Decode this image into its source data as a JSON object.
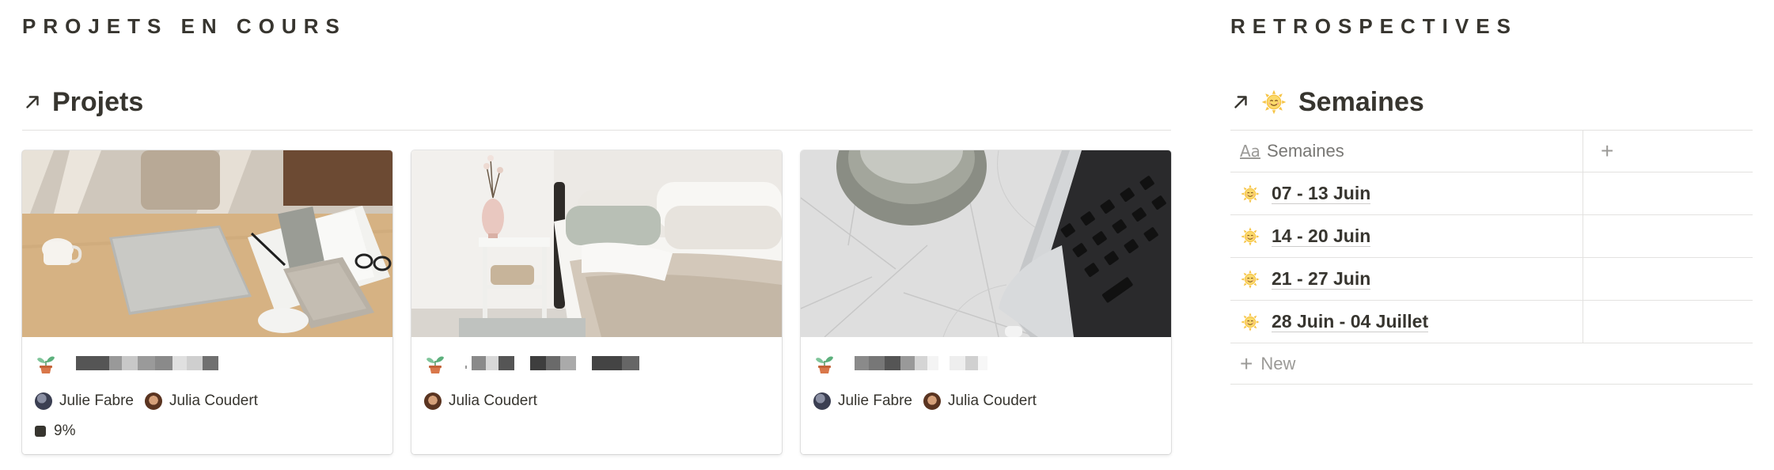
{
  "left": {
    "heading": "PROJETS EN COURS",
    "database": {
      "title": "Projets",
      "icon": "arrow-up-right-icon"
    },
    "cards": [
      {
        "icon": "sprout-icon",
        "title_redacted": true,
        "people": [
          "Julie Fabre",
          "Julia Coudert"
        ],
        "progress": "9%"
      },
      {
        "icon": "sprout-icon",
        "title_redacted": true,
        "people": [
          "Julia Coudert"
        ]
      },
      {
        "icon": "sprout-icon",
        "title_redacted": true,
        "people": [
          "Julie Fabre",
          "Julia Coudert"
        ]
      }
    ]
  },
  "right": {
    "heading": "RETROSPECTIVES",
    "database": {
      "title": "Semaines",
      "icon": "arrow-up-right-icon",
      "emoji": "sun-with-face-icon"
    },
    "table": {
      "column_header": "Semaines",
      "column_icon": "Aa",
      "add_column": "+",
      "rows": [
        "07 - 13 Juin",
        "14 - 20 Juin",
        "21 - 27 Juin",
        "28 Juin - 04 Juillet"
      ],
      "new_label": "New"
    }
  },
  "colors": {
    "text": "#37352f",
    "muted": "#9b9a97",
    "border": "#e3e2e0"
  }
}
